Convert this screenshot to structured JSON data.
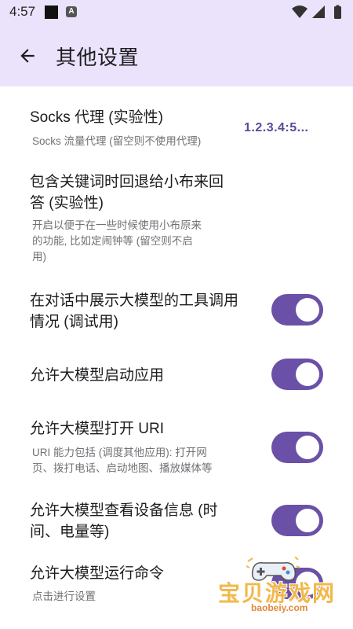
{
  "status_bar": {
    "time": "4:57",
    "badge": "A"
  },
  "app_bar": {
    "title": "其他设置"
  },
  "settings": [
    {
      "title": "Socks 代理 (实验性)",
      "desc": "Socks 流量代理 (留空则不使用代理)",
      "value": "1.2.3.4:5..."
    },
    {
      "title_lines": [
        "包含关键词时回退给小布来回",
        "答 (实验性)"
      ],
      "desc_lines": [
        "开启以便于在一些时候使用小布原来",
        "的功能, 比如定闹钟等 (留空则不启",
        "用)"
      ]
    },
    {
      "title_lines": [
        "在对话中展示大模型的工具调用",
        "情况 (调试用)"
      ],
      "enabled": true
    },
    {
      "title": "允许大模型启动应用",
      "enabled": true
    },
    {
      "title": "允许大模型打开 URI",
      "desc_lines": [
        "URI 能力包括 (调度其他应用): 打开网",
        "页、拨打电话、启动地图、播放媒体等"
      ],
      "enabled": true
    },
    {
      "title_lines": [
        "允许大模型查看设备信息 (时",
        "间、电量等)"
      ],
      "enabled": true
    },
    {
      "title": "允许大模型运行命令",
      "desc": "点击进行设置",
      "enabled": true
    }
  ],
  "watermark": {
    "text": "宝贝游戏网",
    "url": "baobeiy.com"
  },
  "colors": {
    "accent": "#6a50a7",
    "app_bar_bg": "#ebe3fb",
    "value_text": "#5b4a9a"
  }
}
